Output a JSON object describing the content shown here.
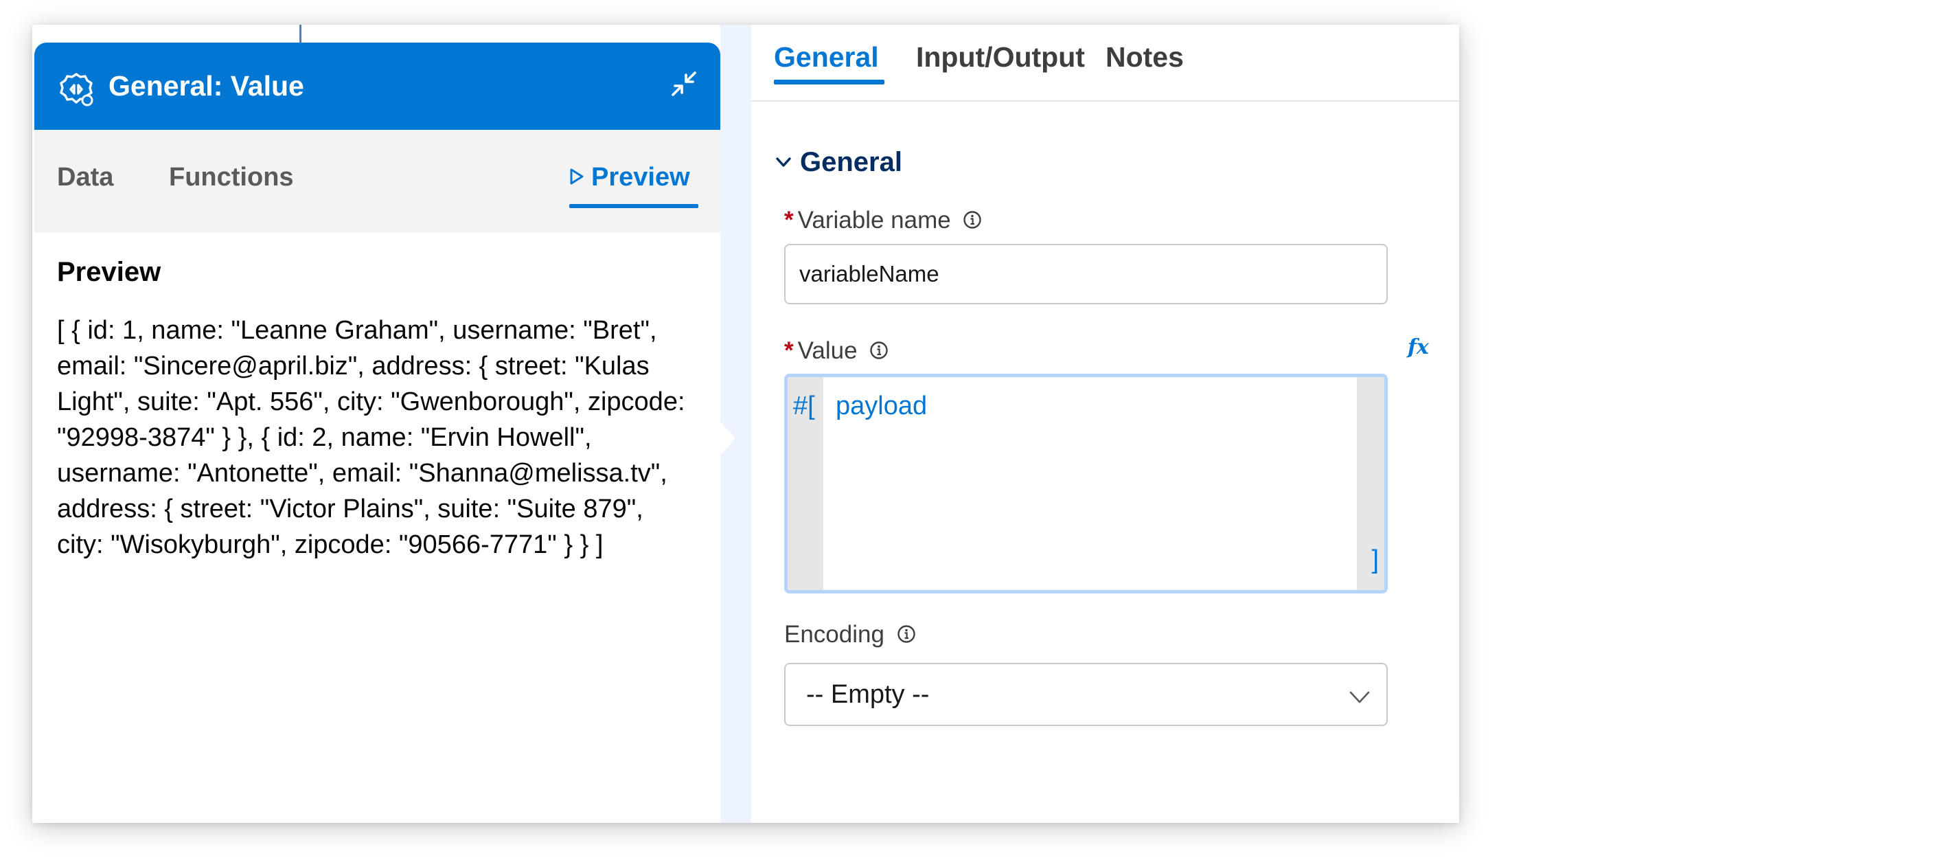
{
  "left_panel": {
    "header_title": "General: Value",
    "header_icon": "component-gear-icon",
    "collapse_icon": "collapse-arrows-icon",
    "tabs": [
      {
        "label": "Data"
      },
      {
        "label": "Functions"
      },
      {
        "label": "Preview",
        "prefix_icon": "play-outline-icon",
        "active": true
      }
    ],
    "preview_heading": "Preview",
    "preview_text": "[ { id: 1, name: \"Leanne Graham\", username: \"Bret\", email: \"Sincere@april.biz\", address: { street: \"Kulas Light\", suite: \"Apt. 556\", city: \"Gwenborough\", zipcode: \"92998-3874\" } }, { id: 2, name: \"Ervin Howell\", username: \"Antonette\", email: \"Shanna@melissa.tv\", address: { street: \"Victor Plains\", suite: \"Suite 879\", city: \"Wisokyburgh\", zipcode: \"90566-7771\" } } ]"
  },
  "right_panel": {
    "tabs": [
      {
        "label": "General",
        "active": true
      },
      {
        "label": "Input/Output"
      },
      {
        "label": "Notes"
      }
    ],
    "section_title": "General",
    "variable_name": {
      "required_mark": "*",
      "label": "Variable name",
      "value": "variableName"
    },
    "value_field": {
      "required_mark": "*",
      "label": "Value",
      "fx_label": "fx",
      "open_token": "#[",
      "code": "payload",
      "close_token": "]"
    },
    "encoding": {
      "label": "Encoding",
      "selected": "-- Empty --"
    }
  },
  "colors": {
    "brand_blue": "#0176d3",
    "header_bg": "#0176d3",
    "required_red": "#ba0517",
    "section_navy": "#032d60"
  }
}
